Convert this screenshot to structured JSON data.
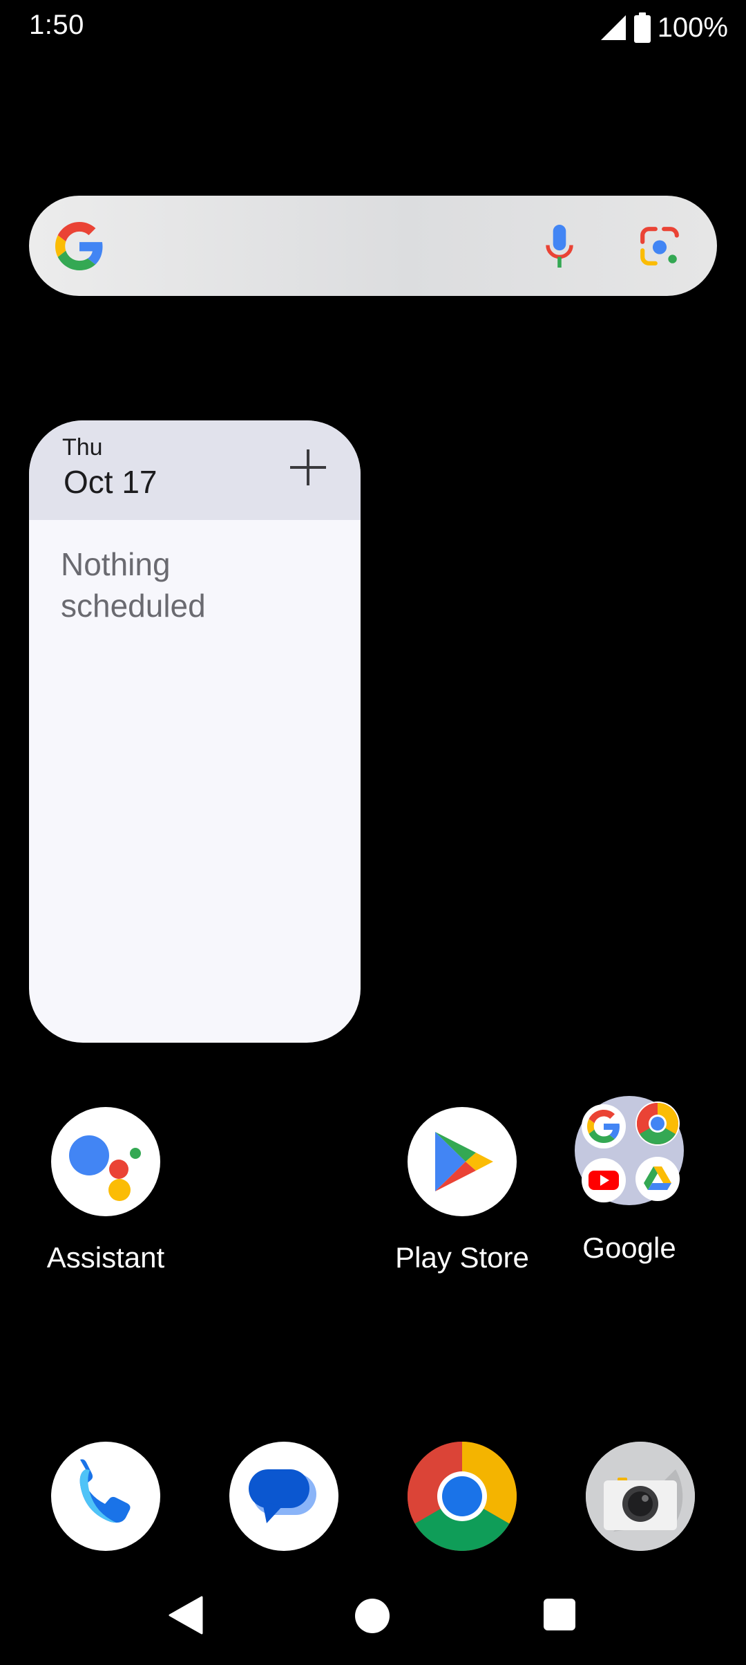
{
  "status_bar": {
    "time": "1:50",
    "battery_text": "100%",
    "icons": [
      "signal-icon",
      "battery-icon"
    ]
  },
  "search_widget": {
    "icons": [
      "google-g-icon",
      "mic-icon",
      "lens-icon"
    ]
  },
  "calendar_widget": {
    "day": "Thu",
    "date": "Oct 17",
    "empty_text": "Nothing scheduled",
    "add_icon": "plus-icon",
    "header_color": "#e1e2ec",
    "body_color": "#f7f7fc"
  },
  "apps": {
    "assistant": {
      "label": "Assistant",
      "icon": "assistant-icon"
    },
    "play_store": {
      "label": "Play Store",
      "icon": "play-store-icon"
    },
    "google_folder": {
      "label": "Google",
      "items": [
        "google-icon",
        "chrome-icon",
        "youtube-icon",
        "drive-icon"
      ]
    }
  },
  "dock": {
    "items": [
      "phone-icon",
      "messages-icon",
      "chrome-icon",
      "camera-icon"
    ]
  },
  "nav_bar": {
    "buttons": [
      "back-icon",
      "home-icon",
      "recents-icon"
    ]
  },
  "colors": {
    "background": "#000000",
    "google_blue": "#4285F4",
    "google_red": "#EA4335",
    "google_yellow": "#FBBC05",
    "google_green": "#34A853"
  }
}
